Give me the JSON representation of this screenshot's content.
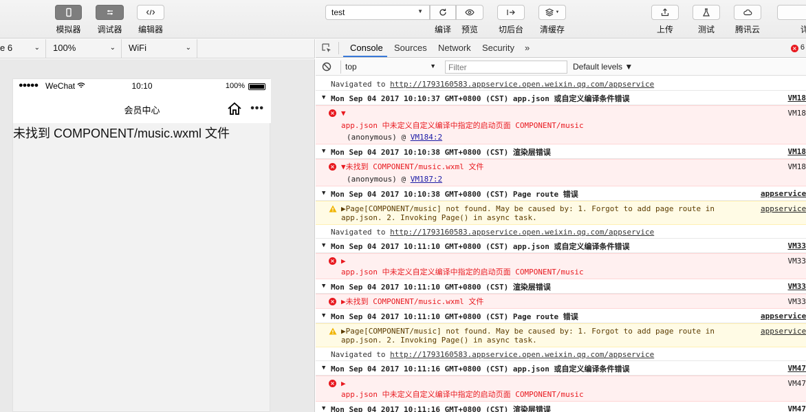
{
  "toolbar": {
    "simulator": "模拟器",
    "debugger": "调试器",
    "editor": "编辑器",
    "project": "test",
    "compile": "编译",
    "preview": "预览",
    "background": "切后台",
    "clear_cache": "清缓存",
    "upload": "上传",
    "test": "测试",
    "tencent_cloud": "腾讯云",
    "details": "详"
  },
  "simbar": {
    "device": "e 6",
    "zoom": "100%",
    "network": "WiFi"
  },
  "phone": {
    "signal": "●●●●●",
    "carrier": "WeChat",
    "time": "10:10",
    "battery": "100%",
    "nav_title": "会员中心",
    "message": "未找到 COMPONENT/music.wxml 文件"
  },
  "devtools": {
    "tabs": [
      "Console",
      "Sources",
      "Network",
      "Security",
      "»"
    ],
    "active_tab": "Console",
    "error_count": "6",
    "context": "top",
    "filter_placeholder": "Filter",
    "levels": "Default levels ▼"
  },
  "console": {
    "nav_prefix": "Navigated to ",
    "nav_url": "http://1793160583.appservice.open.weixin.qq.com/appservice",
    "g1_header": "Mon Sep 04 2017 10:10:37 GMT+0800 (CST) app.json 或自定义编译条件错误",
    "g1_src": "VM18",
    "g1_err_src": "VM18",
    "g1_err_msg": "app.json 中未定义自定义编译中指定的启动页面 COMPONENT/music",
    "g1_anon": "(anonymous) @ ",
    "g1_anon_link": "VM184:2",
    "g2_header": "Mon Sep 04 2017 10:10:38 GMT+0800 (CST) 渲染层错误",
    "g2_src": "VM18",
    "g2_err_src": "VM18",
    "g2_err_msg": "▼未找到 COMPONENT/music.wxml 文件",
    "g2_anon": "(anonymous) @ ",
    "g2_anon_link": "VM187:2",
    "g3_header": "Mon Sep 04 2017 10:10:38 GMT+0800 (CST) Page route 错误",
    "g3_src": "appservice",
    "g3_warn_src": "appservice",
    "g3_warn_line1": "▶Page[COMPONENT/music] not found. May be caused by: 1. Forgot to add page route in",
    "g3_warn_line2": "app.json. 2. Invoking Page() in async task.",
    "g4_header": "Mon Sep 04 2017 10:11:10 GMT+0800 (CST) app.json 或自定义编译条件错误",
    "g4_src": "VM33",
    "g4_err_src": "VM33",
    "g4_err_msg": "app.json 中未定义自定义编译中指定的启动页面 COMPONENT/music",
    "g5_header": "Mon Sep 04 2017 10:11:10 GMT+0800 (CST) 渲染层错误",
    "g5_src": "VM33",
    "g5_err_src": "VM33",
    "g5_err_msg": "▶未找到 COMPONENT/music.wxml 文件",
    "g6_header": "Mon Sep 04 2017 10:11:10 GMT+0800 (CST) Page route 错误",
    "g6_src": "appservice",
    "g6_warn_src": "appservice",
    "g6_warn_line1": "▶Page[COMPONENT/music] not found. May be caused by: 1. Forgot to add page route in",
    "g6_warn_line2": "app.json. 2. Invoking Page() in async task.",
    "g7_header": "Mon Sep 04 2017 10:11:16 GMT+0800 (CST) app.json 或自定义编译条件错误",
    "g7_src": "VM47",
    "g7_err_src": "VM47",
    "g7_err_msg": "app.json 中未定义自定义编译中指定的启动页面 COMPONENT/music",
    "g8_header": "Mon Sep 04 2017 10:11:16 GMT+0800 (CST) 渲染层错误",
    "g8_src": "VM47",
    "tri_down": "▼",
    "tri_right": "▶"
  }
}
